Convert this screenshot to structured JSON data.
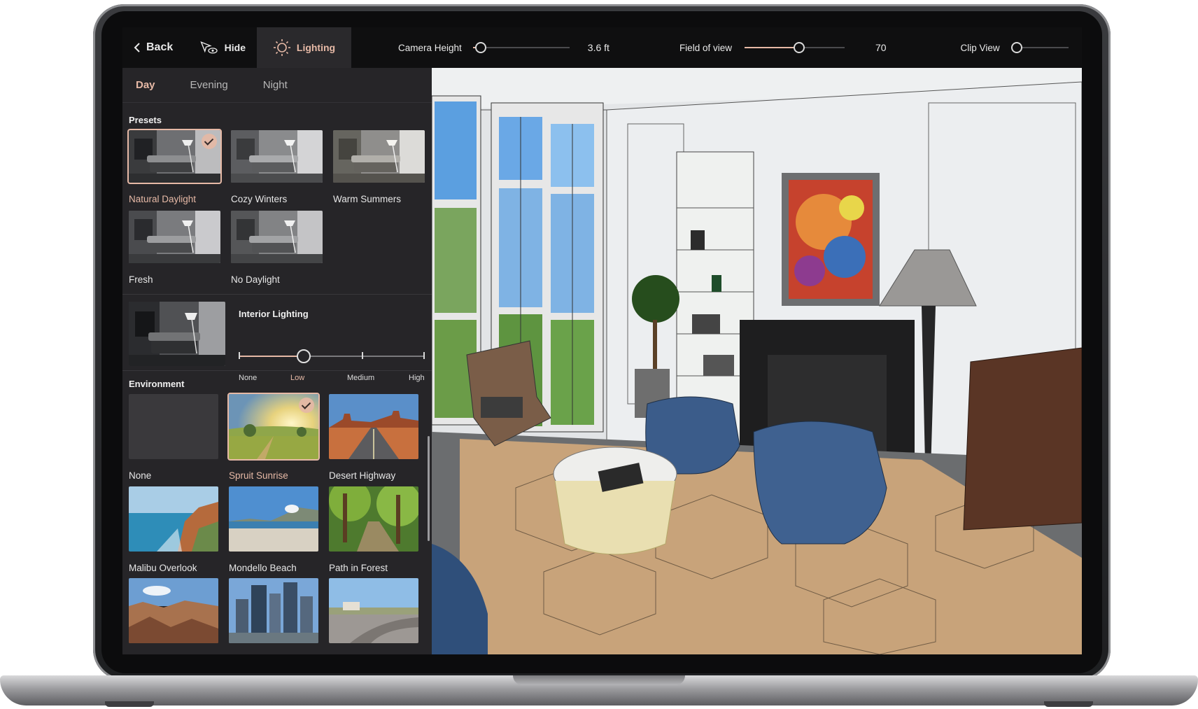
{
  "topbar": {
    "back_label": "Back",
    "hide_label": "Hide",
    "lighting_label": "Lighting",
    "camera_height": {
      "label": "Camera Height",
      "value": "3.6 ft",
      "fraction": 0.08
    },
    "field_of_view": {
      "label": "Field of view",
      "value": "70",
      "fraction": 0.55
    },
    "clip_view": {
      "label": "Clip View",
      "fraction": 0.0
    }
  },
  "time_tabs": [
    {
      "label": "Day",
      "active": true
    },
    {
      "label": "Evening",
      "active": false
    },
    {
      "label": "Night",
      "active": false
    }
  ],
  "presets": {
    "title": "Presets",
    "items": [
      {
        "label": "Natural Daylight",
        "selected": true
      },
      {
        "label": "Cozy Winters",
        "selected": false
      },
      {
        "label": "Warm Summers",
        "selected": false
      },
      {
        "label": "Fresh",
        "selected": false
      },
      {
        "label": "No Daylight",
        "selected": false
      }
    ]
  },
  "interior_lighting": {
    "title": "Interior Lighting",
    "levels": [
      "None",
      "Low",
      "Medium",
      "High"
    ],
    "selected": "Low"
  },
  "environment": {
    "title": "Environment",
    "items": [
      {
        "label": "None",
        "selected": false
      },
      {
        "label": "Spruit Sunrise",
        "selected": true
      },
      {
        "label": "Desert Highway",
        "selected": false
      },
      {
        "label": "Malibu Overlook",
        "selected": false
      },
      {
        "label": "Mondello Beach",
        "selected": false
      },
      {
        "label": "Path in Forest",
        "selected": false
      }
    ]
  },
  "colors": {
    "accent": "#e6b9a6",
    "panel_bg": "#262528",
    "topbar_bg": "#0f0f10"
  },
  "icons": [
    "chevron-left-icon",
    "cursor-eye-icon",
    "sun-icon",
    "checkmark-icon"
  ]
}
